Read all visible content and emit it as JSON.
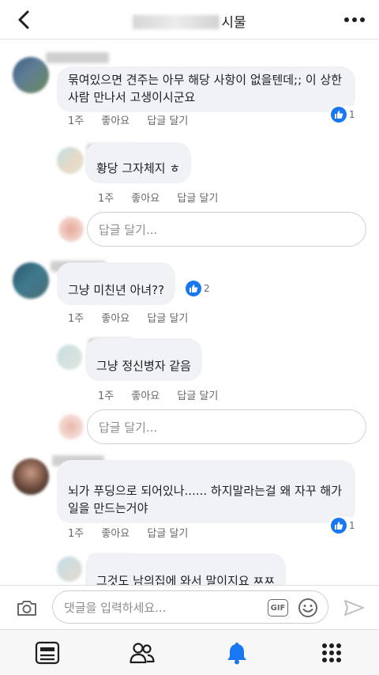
{
  "header": {
    "title_visible": "시물",
    "back_icon": "chevron-left-icon",
    "more_icon": "more-horizontal-icon"
  },
  "comments": [
    {
      "text": "묶여있으면 견주는 아무 해당 사항이 없을텐데;; 이 상한 사람 만나서 고생이시군요",
      "time": "1주",
      "like_label": "좋아요",
      "reply_label": "답글 달기",
      "likes": "1",
      "replies": [
        {
          "text": "황당 그자체지 ㅎ",
          "time": "1주",
          "like_label": "좋아요",
          "reply_label": "답글 달기"
        }
      ],
      "reply_placeholder": "답글 달기..."
    },
    {
      "text": "그냥 미친년 아녀??",
      "time": "1주",
      "like_label": "좋아요",
      "reply_label": "답글 달기",
      "likes": "2",
      "replies": [
        {
          "text": "그냥 정신병자 같음",
          "time": "1주",
          "like_label": "좋아요",
          "reply_label": "답글 달기"
        }
      ],
      "reply_placeholder": "답글 달기..."
    },
    {
      "text": "뇌가 푸딩으로 되어있나...... 하지말라는걸 왜 자꾸 해가 일을 만드는거야",
      "time": "1주",
      "like_label": "좋아요",
      "reply_label": "답글 달기",
      "likes": "1",
      "replies": [
        {
          "text": "그것도 남의집에 와서 말이지요 ㅉㅉ"
        }
      ]
    }
  ],
  "compose": {
    "placeholder": "댓글을 입력하세요...",
    "gif_label": "GIF"
  },
  "bottom_nav": [
    {
      "icon": "news-feed-icon"
    },
    {
      "icon": "friends-icon"
    },
    {
      "icon": "notifications-bell-icon",
      "active": true
    },
    {
      "icon": "menu-grid-icon"
    }
  ],
  "colors": {
    "accent": "#1877f2",
    "bubble": "#f0f2f5",
    "meta_text": "#65676b"
  }
}
